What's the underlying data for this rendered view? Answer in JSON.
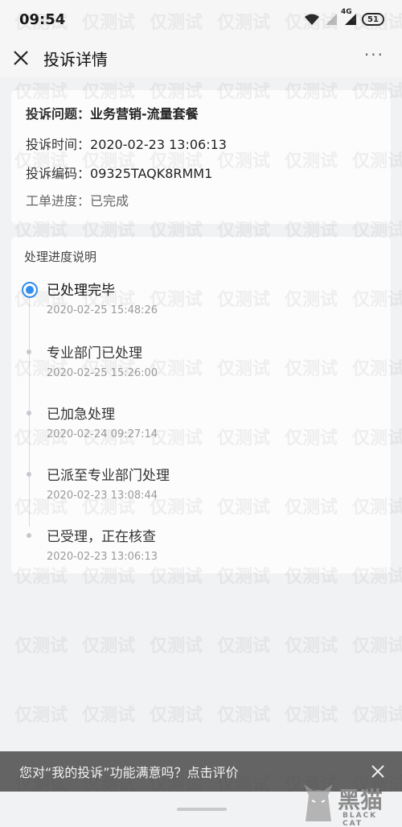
{
  "status_bar": {
    "time": "09:54",
    "network": "4G",
    "battery": "51",
    "icons": [
      "wifi-icon",
      "signal-icon",
      "signal-4g-icon",
      "battery-icon"
    ]
  },
  "nav": {
    "title": "投诉详情",
    "more": "···"
  },
  "complaint": {
    "issue_label": "投诉问题：",
    "issue_value": "业务营销-流量套餐",
    "time_label": "投诉时间：",
    "time_value": "2020-02-23 13:06:13",
    "code_label": "投诉编码：",
    "code_value": "09325TAQK8RMM1",
    "progress_label": "工单进度：",
    "progress_value": "已完成"
  },
  "progress": {
    "title": "处理进度说明",
    "steps": [
      {
        "label": "已处理完毕",
        "time": "2020-02-25 15:48:26",
        "active": true
      },
      {
        "label": "专业部门已处理",
        "time": "2020-02-25 15:26:00",
        "active": false
      },
      {
        "label": "已加急处理",
        "time": "2020-02-24 09:27:14",
        "active": false
      },
      {
        "label": "已派至专业部门处理",
        "time": "2020-02-23 13:08:44",
        "active": false
      },
      {
        "label": "已受理，正在核查",
        "time": "2020-02-23 13:06:13",
        "active": false
      }
    ]
  },
  "feedback": {
    "text": "您对“我的投诉”功能满意吗？点击评价"
  },
  "watermark": {
    "text": "仅测试"
  },
  "logo": {
    "text": "黑猫",
    "sub": "BLACK CAT"
  },
  "colors": {
    "accent": "#2f8ef0",
    "background": "#f1f2f4",
    "card": "#fcfcfd",
    "bottom_bar": "#3c3c3c"
  }
}
